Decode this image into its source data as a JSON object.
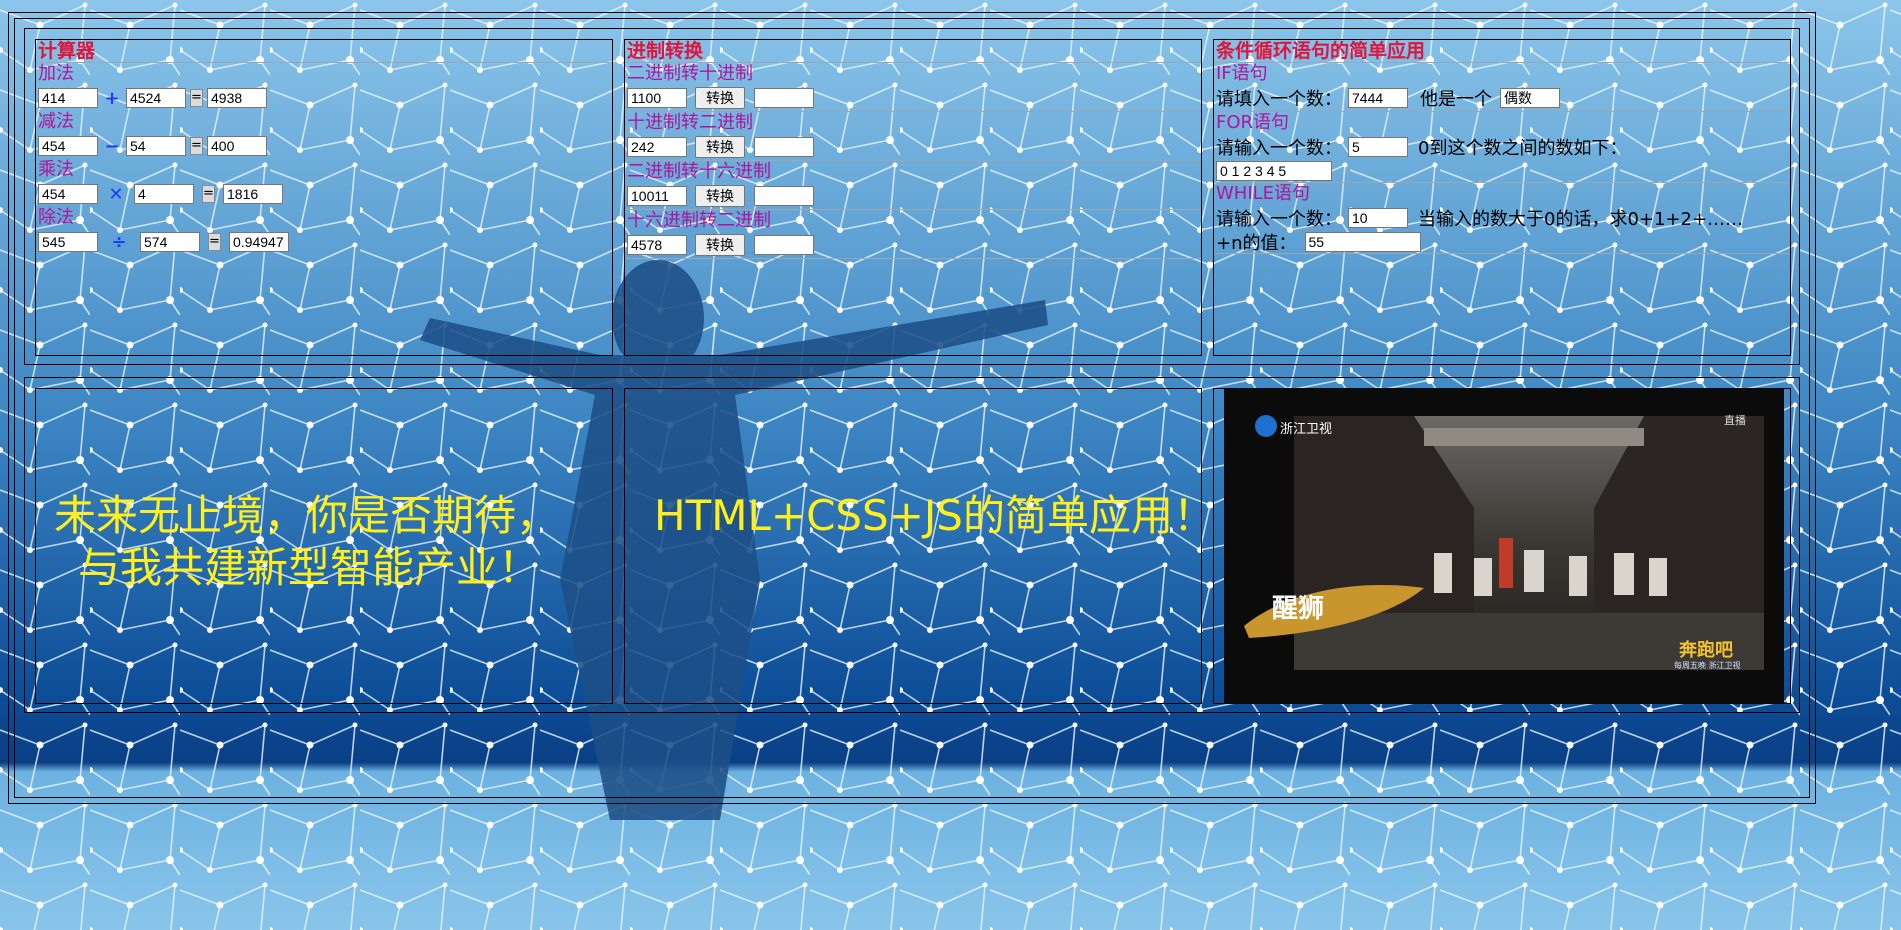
{
  "calculator": {
    "title": "计算器",
    "add": {
      "label": "加法",
      "a": "414",
      "op": "+",
      "b": "4524",
      "eq": "=",
      "result": "4938"
    },
    "sub": {
      "label": "减法",
      "a": "454",
      "op": "−",
      "b": "54",
      "eq": "=",
      "result": "400"
    },
    "mul": {
      "label": "乘法",
      "a": "454",
      "op": "✕",
      "b": "4",
      "eq": "=",
      "result": "1816"
    },
    "div": {
      "label": "除法",
      "a": "545",
      "op": "÷",
      "b": "574",
      "eq": "=",
      "result": "0.94947"
    }
  },
  "conversion": {
    "title": "进制转换",
    "button_label": "转换",
    "items": [
      {
        "label": "二进制转十进制",
        "value": "1100",
        "result": ""
      },
      {
        "label": "十进制转二进制",
        "value": "242",
        "result": ""
      },
      {
        "label": "二进制转十六进制",
        "value": "10011",
        "result": ""
      },
      {
        "label": "十六进制转二进制",
        "value": "4578",
        "result": ""
      }
    ]
  },
  "loops": {
    "title": "条件循环语句的简单应用",
    "if": {
      "label": "IF语句",
      "prompt": "请填入一个数：",
      "value": "7444",
      "middle": "他是一个",
      "result": "偶数"
    },
    "for": {
      "label": "FOR语句",
      "prompt": "请输入一个数：",
      "value": "5",
      "suffix": "0到这个数之间的数如下：",
      "result": "0 1 2 3 4 5"
    },
    "while": {
      "label": "WHILE语句",
      "prompt": "请输入一个数：",
      "value": "10",
      "suffix": "当输入的数大于0的话，求0+1+2+……",
      "line2": "+n的值：",
      "result": "55"
    }
  },
  "slogans": {
    "left_line1": "未来无止境，你是否期待，",
    "left_line2": "与我共建新型智能产业！",
    "center": "HTML+CSS+JS的简单应用！"
  },
  "video": {
    "channel": "浙江卫视",
    "corner": "直播",
    "caption": "醒狮",
    "show_logo": "奔跑吧",
    "show_sub": "每周五晚 浙江卫视"
  },
  "colors": {
    "title_red": "#e0143c",
    "label_purple": "#b0149b",
    "slogan_yellow": "#ffef1c",
    "operator_blue": "#1a3cff"
  }
}
